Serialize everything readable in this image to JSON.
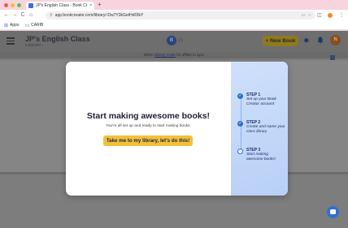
{
  "browser": {
    "tab_title": "JP's English Class - Book Cr",
    "tab_close": "×",
    "new_tab": "+",
    "url": "app.bookcreator.com/library/-Dw7Y3kGetHdOlkY",
    "back": "←",
    "forward": "→",
    "reload": "C",
    "home": "⌂",
    "bookmarks": [
      {
        "label": "Apps",
        "icon": "apps-grid-icon"
      },
      {
        "label": "CARIB",
        "icon": "folder-icon"
      }
    ]
  },
  "header": {
    "class_title": "JP's English Class",
    "class_subtitle": "0 BOOKS ›",
    "badge_letter": "B",
    "new_book_label": "+ New Book",
    "avatar_letter": "N"
  },
  "banner": {
    "prefix": "When ",
    "link": "Library mode",
    "suffix": " for offline to sync"
  },
  "modal": {
    "title": "Start making awesome books!",
    "description": "You're all set up and ready to start making books.",
    "cta_label": "Take me to my library, let's do this!",
    "steps": [
      {
        "label": "STEP 1",
        "text": "Set up your Book Creator account",
        "done": true
      },
      {
        "label": "STEP 2",
        "text": "Create and name your class library",
        "done": true
      },
      {
        "label": "STEP 3",
        "text": "Start making awesome books!",
        "done": false
      }
    ]
  },
  "colors": {
    "accent_blue": "#2f6fd8",
    "cta_yellow": "#f2c13c",
    "navy": "#1c2c63"
  }
}
